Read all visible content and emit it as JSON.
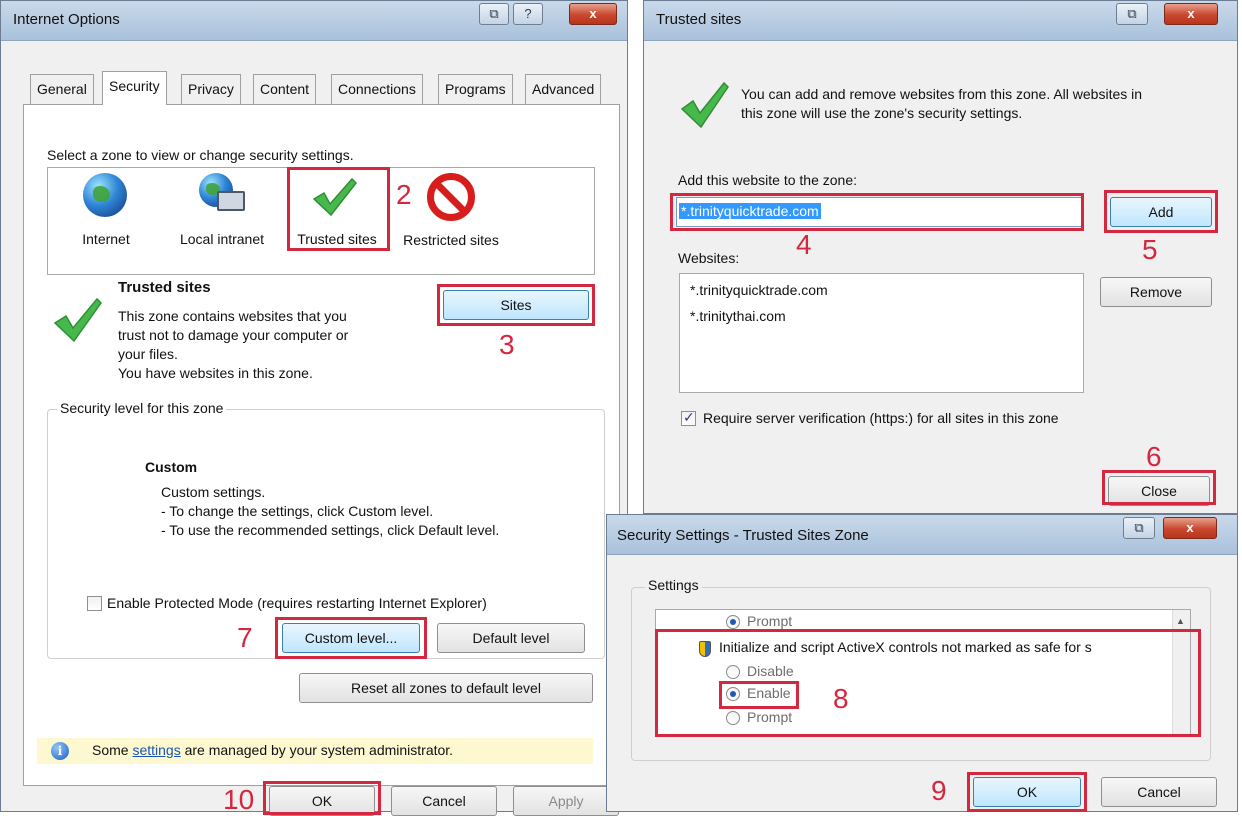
{
  "internet_options": {
    "title": "Internet Options",
    "title_buttons": [
      "⧉",
      "?",
      "x"
    ],
    "tabs": [
      "General",
      "Security",
      "Privacy",
      "Content",
      "Connections",
      "Programs",
      "Advanced"
    ],
    "zone_prompt": "Select a zone to view or change security settings.",
    "zones": [
      "Internet",
      "Local intranet",
      "Trusted sites",
      "Restricted sites"
    ],
    "zone_title": "Trusted sites",
    "zone_description": [
      "This zone contains websites that you",
      "trust not to damage your computer or",
      "your files.",
      "You have websites in this zone."
    ],
    "sites_button": "Sites",
    "security_level_label": "Security level for this zone",
    "level_name": "Custom",
    "level_lines": [
      "Custom settings.",
      "- To change the settings, click Custom level.",
      "- To use the recommended settings, click Default level."
    ],
    "protected_mode_label": "Enable Protected Mode (requires restarting Internet Explorer)",
    "custom_level_button": "Custom level...",
    "default_level_button": "Default level",
    "reset_button": "Reset all zones to default level",
    "info_before": "Some ",
    "info_link": "settings",
    "info_after": " are managed by your system administrator.",
    "ok_button": "OK",
    "cancel_button": "Cancel",
    "apply_button": "Apply"
  },
  "trusted_sites": {
    "title": "Trusted sites",
    "title_buttons": [
      "⧉",
      "x"
    ],
    "description": [
      "You can add and remove websites from this zone. All websites in",
      "this zone will use the zone's security settings."
    ],
    "add_label": "Add this website to the zone:",
    "add_value": "*.trinityquicktrade.com",
    "add_button": "Add",
    "websites_label": "Websites:",
    "websites": [
      "*.trinityquicktrade.com",
      "*.trinitythai.com"
    ],
    "remove_button": "Remove",
    "require_label": "Require server verification (https:) for all sites in this zone",
    "require_checked": true,
    "close_button": "Close"
  },
  "security_settings": {
    "title": "Security Settings - Trusted Sites Zone",
    "title_buttons": [
      "⧉",
      "x"
    ],
    "settings_label": "Settings",
    "options": [
      "Prompt",
      "Disable",
      "Enable",
      "Prompt"
    ],
    "setting_name": "Initialize and script ActiveX controls not marked as safe for s",
    "scroll_up": "▲",
    "ok_button": "OK",
    "cancel_button": "Cancel"
  },
  "markers": [
    "2",
    "3",
    "4",
    "5",
    "6",
    "7",
    "8",
    "9",
    "10"
  ],
  "colors": {
    "annotation": "#d3283f",
    "check": "#47b84b"
  }
}
